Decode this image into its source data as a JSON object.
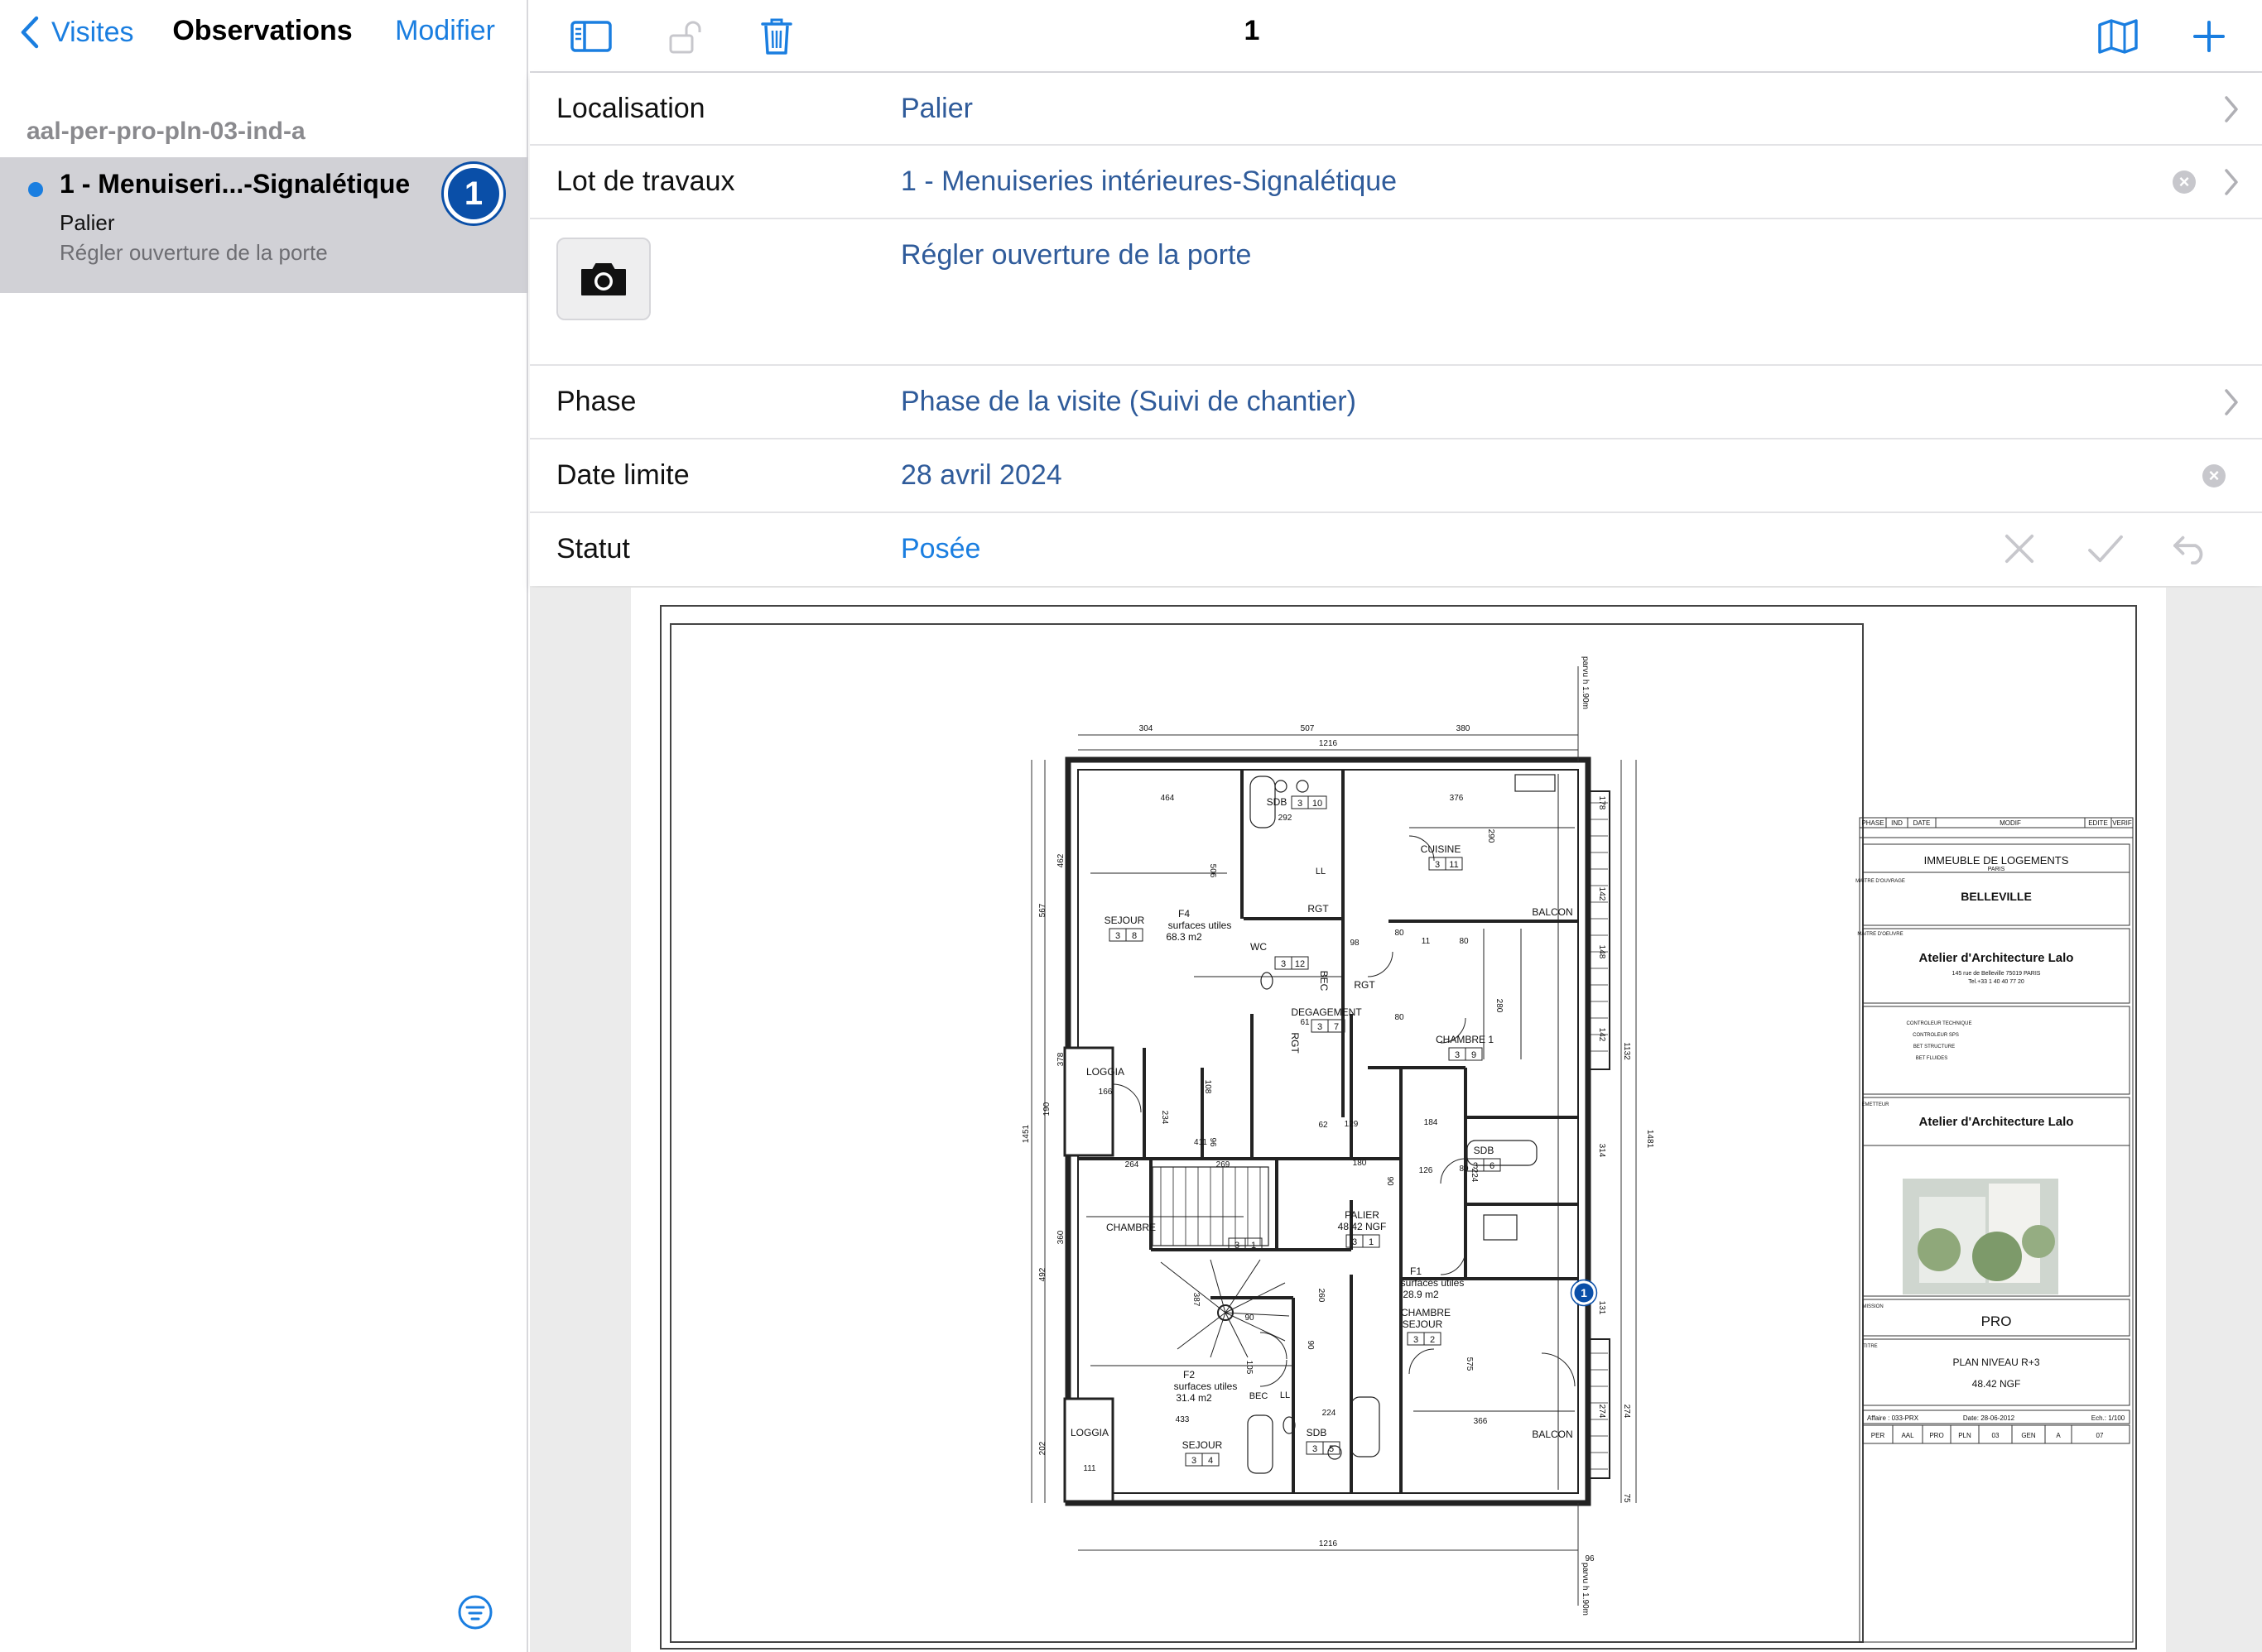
{
  "sidebar": {
    "back_label": "Visites",
    "title": "Observations",
    "edit_label": "Modifier",
    "group_header": "aal-per-pro-pln-03-ind-a",
    "items": [
      {
        "title": "1 - Menuiseri...-Signalétique",
        "location": "Palier",
        "description": "Régler ouverture de la porte",
        "badge": "1",
        "selected": true
      }
    ]
  },
  "toolbar": {
    "title": "1",
    "icons": [
      "sidebar-toggle-icon",
      "lock-open-icon",
      "trash-icon",
      "map-icon",
      "plus-icon"
    ]
  },
  "form": {
    "localisation": {
      "label": "Localisation",
      "value": "Palier"
    },
    "lot": {
      "label": "Lot de travaux",
      "value": "1 - Menuiseries intérieures-Signalétique"
    },
    "description": {
      "value": "Régler ouverture de la porte"
    },
    "phase": {
      "label": "Phase",
      "value": "Phase de la visite (Suivi de chantier)"
    },
    "date": {
      "label": "Date limite",
      "value": "28 avril 2024"
    },
    "status": {
      "label": "Statut",
      "value": "Posée"
    }
  },
  "colors": {
    "accent": "#1a7ee0",
    "value_text": "#2f5b9a",
    "selected_row": "#d1d1d6",
    "badge": "#0a4fa8"
  },
  "plan": {
    "marker": "1",
    "dims_top": [
      "304",
      "507",
      "380",
      "1216"
    ],
    "dims_bottom": [
      "1216",
      "96"
    ],
    "dims_left": [
      "462",
      "567",
      "378",
      "190",
      "1451",
      "360",
      "492",
      "202"
    ],
    "dims_right": [
      "178",
      "142",
      "148",
      "142",
      "1132",
      "314",
      "1481",
      "131",
      "274",
      "274",
      "75"
    ],
    "parvu": "parvu h 1.90m",
    "rooms": [
      {
        "name": "SEJOUR",
        "code": [
          "3",
          "8"
        ]
      },
      {
        "name": "F4",
        "sub": "surfaces utiles",
        "area": "68.3 m2"
      },
      {
        "name": "SDB",
        "code": [
          "3",
          "10"
        ],
        "dim": "292"
      },
      {
        "name": "CUISINE",
        "code": [
          "3",
          "11"
        ]
      },
      {
        "name": "WC",
        "code": [
          "3",
          "12"
        ]
      },
      {
        "name": "RGT"
      },
      {
        "name": "BEC"
      },
      {
        "name": "LL"
      },
      {
        "name": "BALCON"
      },
      {
        "name": "DEGAGEMENT",
        "code": [
          "3",
          "7"
        ]
      },
      {
        "name": "CHAMBRE 1",
        "code": [
          "3",
          "9"
        ]
      },
      {
        "name": "LOGGIA",
        "dim": "166"
      },
      {
        "name": "SDB",
        "code": [
          "3",
          "6"
        ]
      },
      {
        "name": "CHAMBRE"
      },
      {
        "name": "PALIER",
        "level": "48.42 NGF",
        "code": [
          "3",
          "1"
        ]
      },
      {
        "name": "F1",
        "sub": "surfaces utiles",
        "area": "28.9 m2"
      },
      {
        "name": "CHAMBRE",
        "name2": "SEJOUR",
        "code": [
          "3",
          "2"
        ]
      },
      {
        "name": "F2",
        "sub": "surfaces utiles",
        "area": "31.4 m2"
      },
      {
        "name": "LOGGIA",
        "dim": "111"
      },
      {
        "name": "SEJOUR",
        "code": [
          "3",
          "4"
        ]
      },
      {
        "name": "SDB",
        "code": [
          "3",
          "5"
        ]
      },
      {
        "name": "BALCON"
      }
    ],
    "inner_dims": [
      "464",
      "376",
      "290",
      "506",
      "98",
      "80",
      "80",
      "280",
      "411",
      "234",
      "108",
      "96",
      "129",
      "62",
      "184",
      "180",
      "224",
      "126",
      "90",
      "264",
      "269",
      "387",
      "260",
      "90",
      "105",
      "90",
      "224",
      "433",
      "366",
      "575",
      "111",
      "80",
      "11",
      "80",
      "61"
    ],
    "cartouche": {
      "header_cols": [
        "PHASE",
        "IND",
        "DATE",
        "MODIF",
        "EDITE",
        "VERIF"
      ],
      "project": "IMMEUBLE DE LOGEMENTS",
      "city": "PARIS",
      "moa_label": "MAITRE D'OUVRAGE",
      "client": "BELLEVILLE",
      "moe_label": "MAITRE D'OEUVRE",
      "architect": "Atelier d'Architecture Lalo",
      "address": "145 rue de Belleville 75019 PARIS",
      "tel": "Tel.+33 1 40 40 77 20",
      "controls": [
        "CONTROLEUR TECHNIQUE",
        "CONTROLEUR SPS",
        "BET STRUCTURE",
        "BET FLUIDES"
      ],
      "emitter_label": "EMETTEUR",
      "emitter": "Atelier d'Architecture Lalo",
      "mission_label": "MISSION",
      "mission": "PRO",
      "title_label": "TITRE",
      "plan_title": "PLAN NIVEAU R+3",
      "plan_level": "48.42 NGF",
      "affaire": "Affaire : 033-PRX",
      "date": "Date: 28-06-2012",
      "scale": "Ech.: 1/100",
      "codes": [
        "PER",
        "AAL",
        "PRO",
        "PLN",
        "03",
        "GEN",
        "A",
        "07"
      ]
    }
  }
}
